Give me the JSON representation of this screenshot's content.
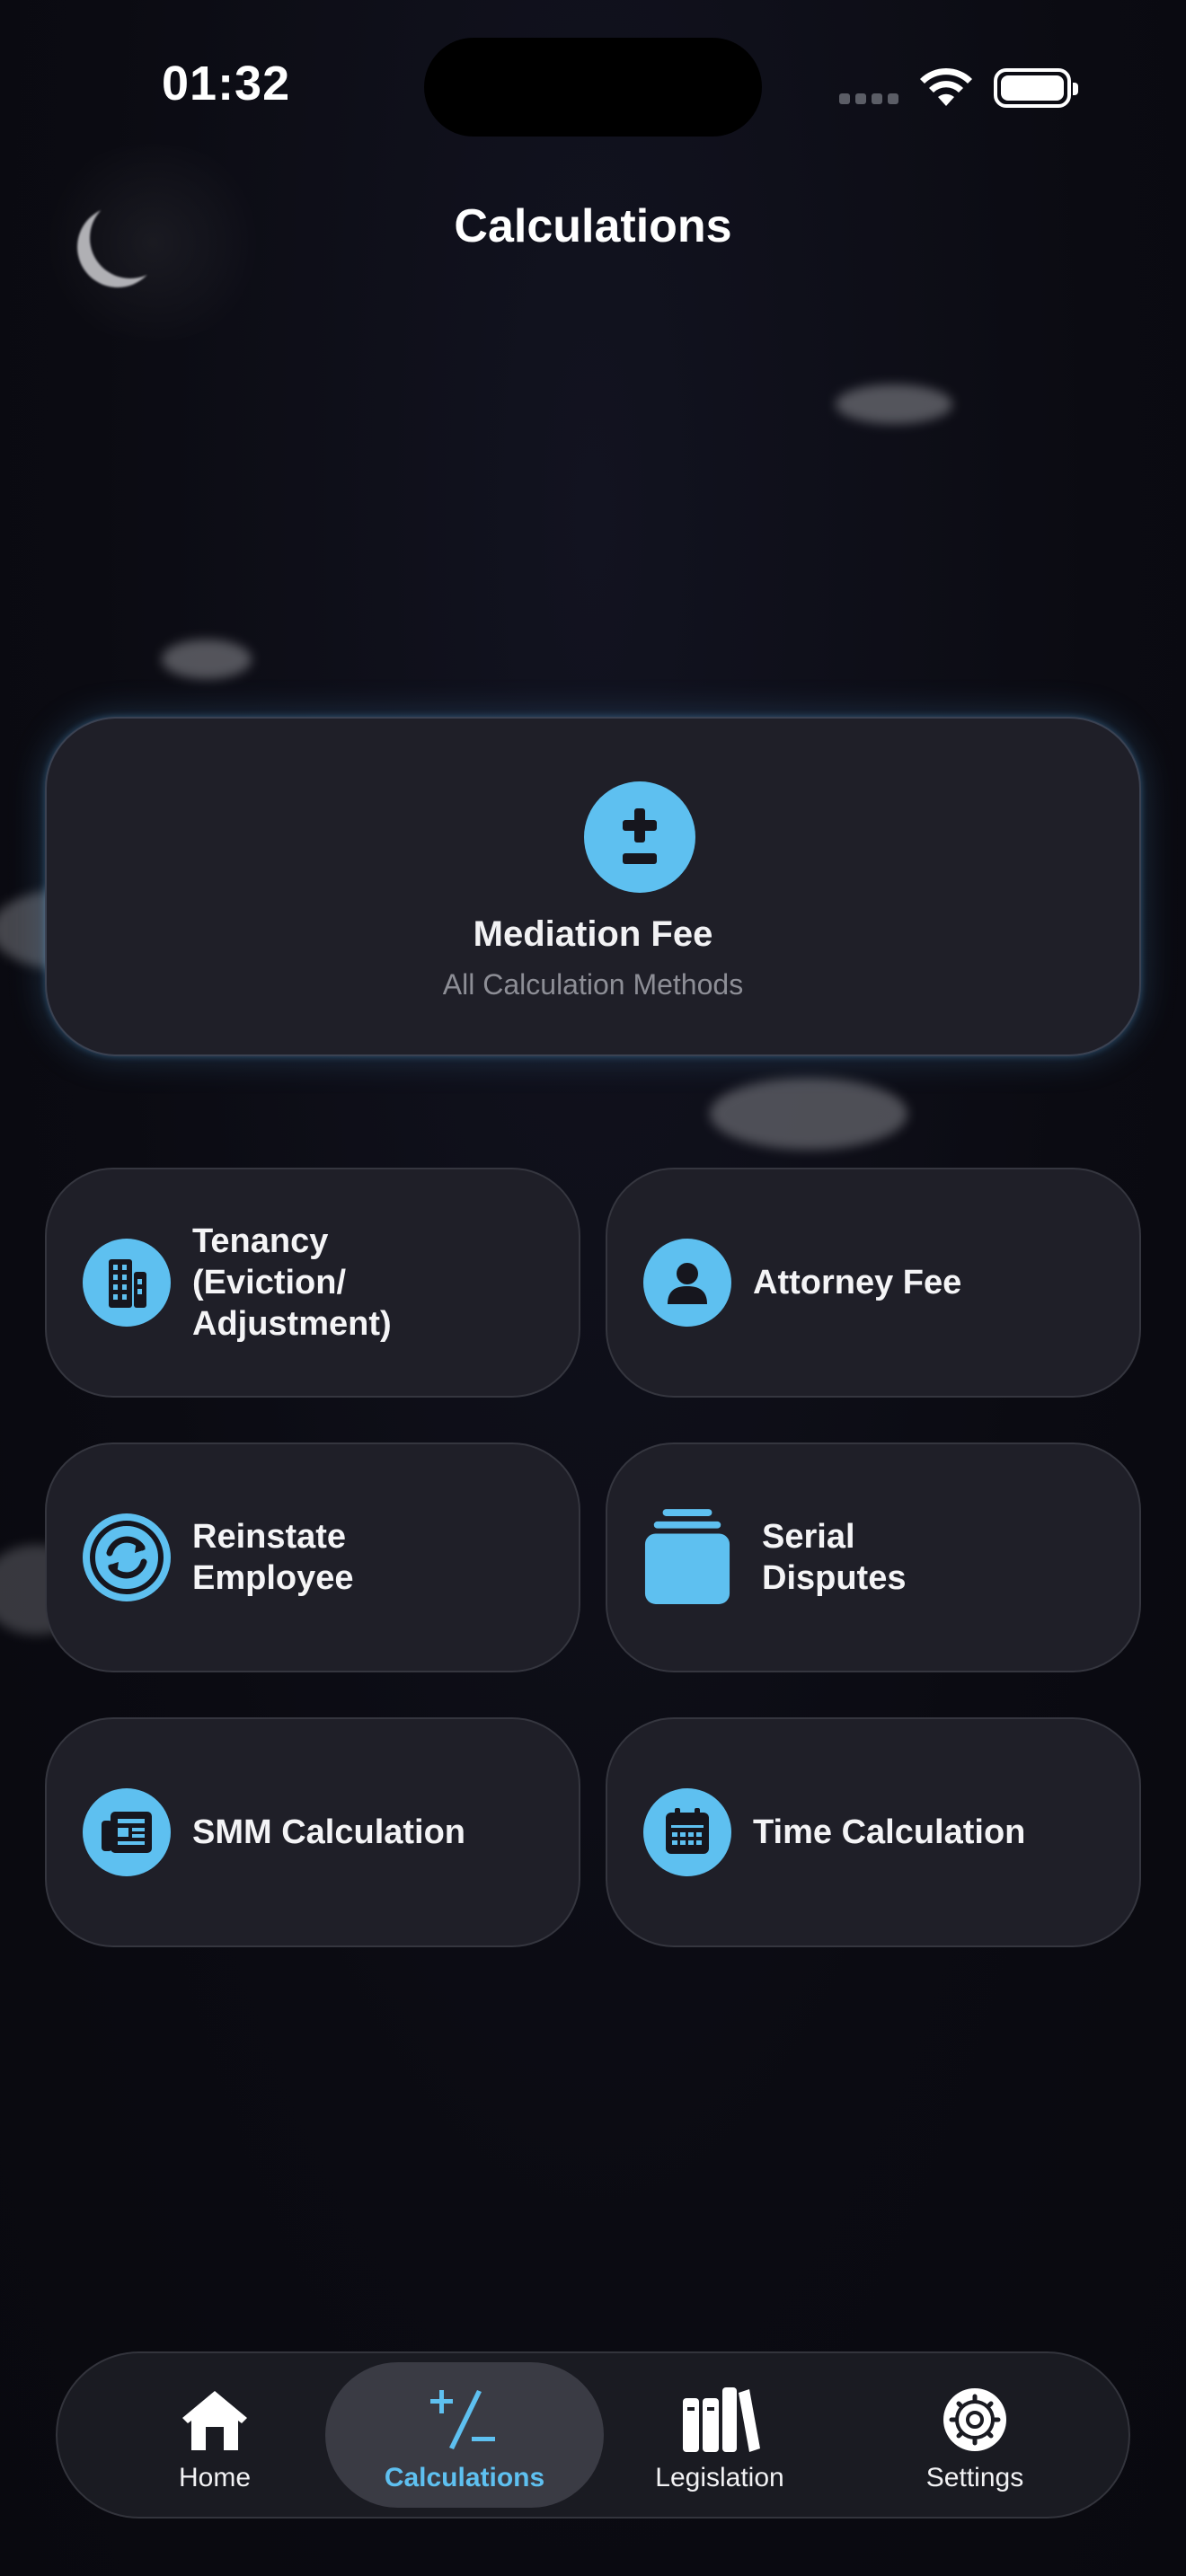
{
  "status": {
    "time": "01:32"
  },
  "header": {
    "title": "Calculations"
  },
  "featured": {
    "title": "Mediation Fee",
    "subtitle": "All Calculation Methods",
    "icon": "plus-minus-icon"
  },
  "tiles": [
    {
      "label_lines": [
        "Tenancy",
        "(Eviction/",
        "Adjustment)"
      ],
      "icon": "building-icon"
    },
    {
      "label_lines": [
        "Attorney Fee"
      ],
      "icon": "person-icon"
    },
    {
      "label_lines": [
        "Reinstate",
        "Employee"
      ],
      "icon": "refresh-icon"
    },
    {
      "label_lines": [
        "Serial",
        "Disputes"
      ],
      "icon": "stack-icon"
    },
    {
      "label_lines": [
        "SMM Calculation"
      ],
      "icon": "newspaper-icon"
    },
    {
      "label_lines": [
        "Time Calculation"
      ],
      "icon": "calendar-icon"
    }
  ],
  "tabbar": {
    "items": [
      {
        "label": "Home",
        "icon": "home-icon",
        "active": false
      },
      {
        "label": "Calculations",
        "icon": "plus-slash-minus-icon",
        "active": true
      },
      {
        "label": "Legislation",
        "icon": "books-icon",
        "active": false
      },
      {
        "label": "Settings",
        "icon": "gear-icon",
        "active": false
      }
    ]
  },
  "colors": {
    "accent": "#5ec0f0",
    "background": "#0c0c14",
    "card": "#1f1f28"
  }
}
